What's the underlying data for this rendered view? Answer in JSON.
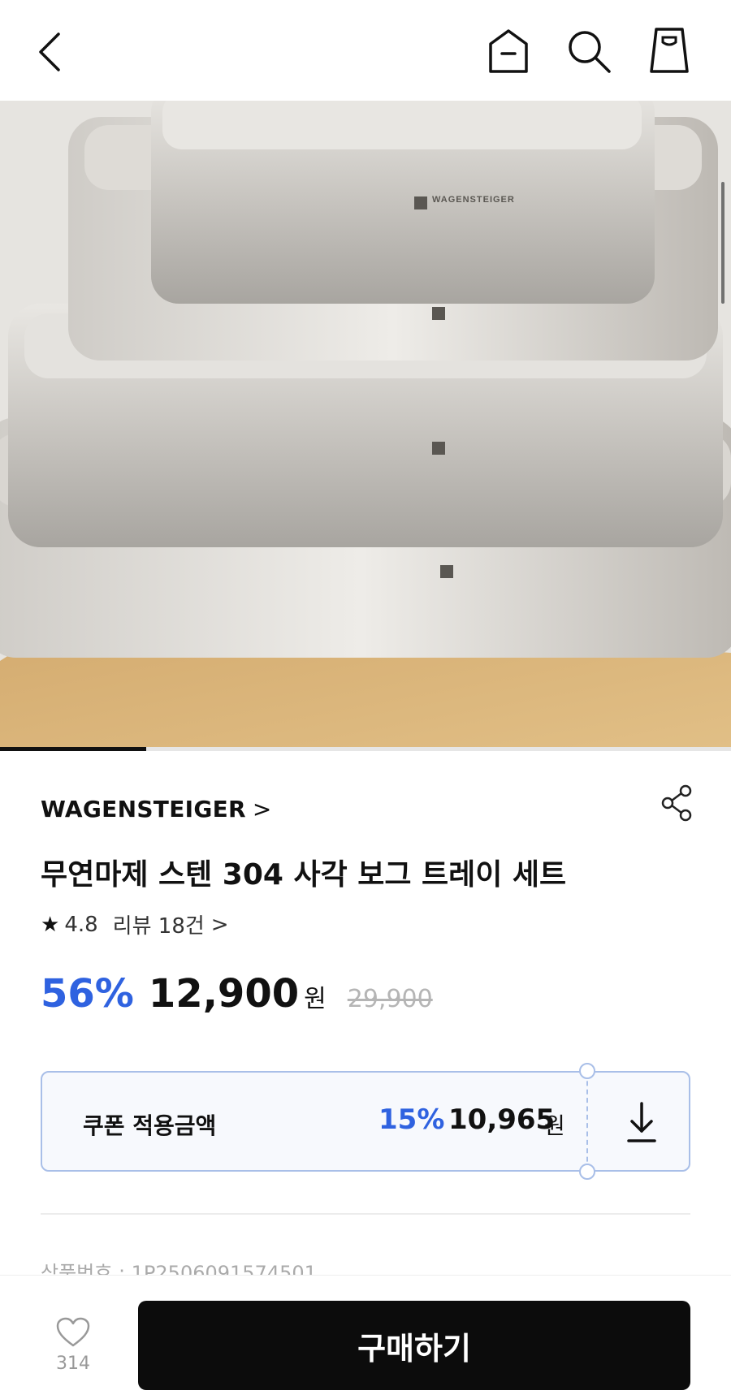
{
  "header": {
    "icons": [
      "back-icon",
      "home-icon",
      "search-icon",
      "shopping-bag-icon"
    ]
  },
  "gallery": {
    "image_description_icon": "product-image",
    "logo_text": "WAGENSTEIGER",
    "progress": 0.2
  },
  "product": {
    "brand": "WAGENSTEIGER",
    "brand_chevron": ">",
    "title": "무연마제 스텐 304 사각 보그 트레이 세트",
    "rating": "4.8",
    "review_label": "리뷰 18건",
    "review_chevron": ">",
    "discount": "56%",
    "price": "12,900",
    "currency": "원",
    "original_price": "29,900",
    "product_code": "상품번호 : 1P2506091574501"
  },
  "coupon": {
    "label": "쿠폰 적용금액",
    "discount": "15%",
    "price": "10,965",
    "currency": "원"
  },
  "bottom_bar": {
    "like_count": "314",
    "buy_label": "구매하기"
  },
  "colors": {
    "accent_blue": "#2f62e0",
    "coupon_border": "#a9bfe8",
    "buy_button": "#0c0c0c"
  }
}
